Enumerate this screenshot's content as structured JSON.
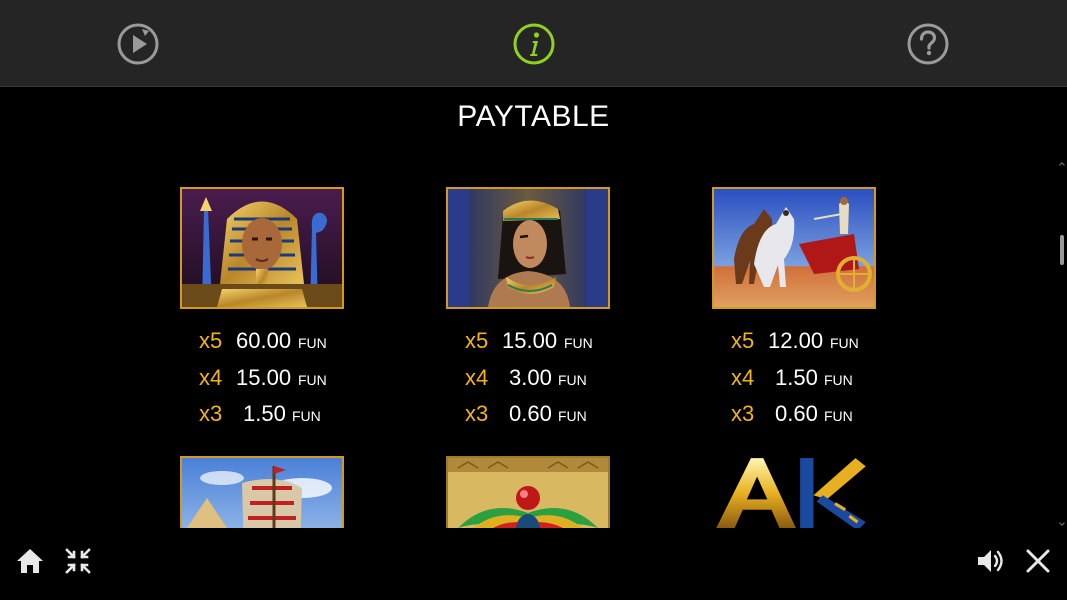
{
  "header": {
    "buttons": [
      {
        "name": "replay",
        "icon": "replay-icon"
      },
      {
        "name": "info",
        "icon": "info-icon",
        "active": true,
        "color": "#8fd11f"
      },
      {
        "name": "help",
        "icon": "help-icon"
      }
    ]
  },
  "title": "PAYTABLE",
  "currency": "FUN",
  "symbols": [
    {
      "icon": "pharaoh-symbol",
      "pays": [
        {
          "mult": "x5",
          "value": "60.00"
        },
        {
          "mult": "x4",
          "value": "15.00"
        },
        {
          "mult": "x3",
          "value": "1.50"
        }
      ]
    },
    {
      "icon": "queen-symbol",
      "pays": [
        {
          "mult": "x5",
          "value": "15.00"
        },
        {
          "mult": "x4",
          "value": "3.00"
        },
        {
          "mult": "x3",
          "value": "0.60"
        }
      ]
    },
    {
      "icon": "chariot-symbol",
      "pays": [
        {
          "mult": "x5",
          "value": "12.00"
        },
        {
          "mult": "x4",
          "value": "1.50"
        },
        {
          "mult": "x3",
          "value": "0.60"
        }
      ]
    }
  ],
  "partial_symbols": [
    {
      "icon": "ship-symbol"
    },
    {
      "icon": "scarab-symbol"
    },
    {
      "icon": "ak-symbol",
      "letters": "AK"
    }
  ],
  "footer": {
    "left": [
      {
        "icon": "home-icon"
      },
      {
        "icon": "collapse-icon"
      }
    ],
    "right": [
      {
        "icon": "sound-icon"
      },
      {
        "icon": "close-icon"
      }
    ]
  },
  "colors": {
    "accent": "#8fd11f",
    "multiplier": "#f3b31a",
    "frame": "#d49a1f",
    "header_bg": "#252525"
  }
}
